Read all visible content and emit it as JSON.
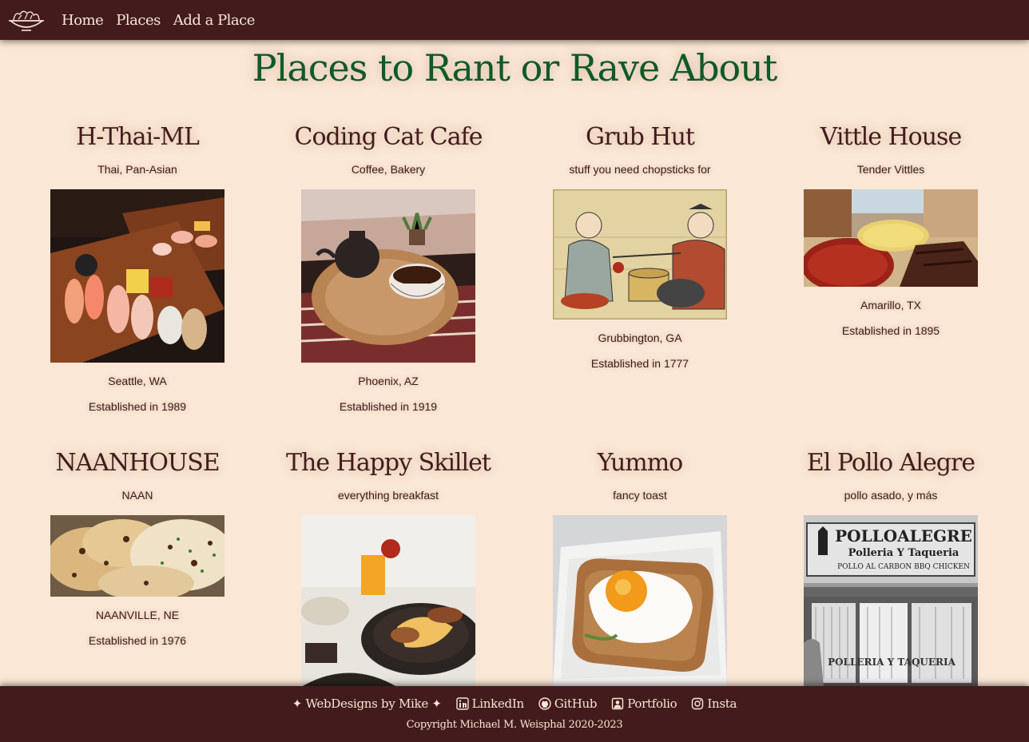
{
  "nav": {
    "logo_icon": "salad-bowl-icon",
    "items": [
      {
        "label": "Home"
      },
      {
        "label": "Places"
      },
      {
        "label": "Add a Place"
      }
    ]
  },
  "page": {
    "title": "Places to Rant or Rave About"
  },
  "places": [
    {
      "name": "H-Thai-ML",
      "cuisine": "Thai, Pan-Asian",
      "city": "Seattle, WA",
      "founded": "Established in 1989",
      "photo": "sushi-platter"
    },
    {
      "name": "Coding Cat Cafe",
      "cuisine": "Coffee, Bakery",
      "city": "Phoenix, AZ",
      "founded": "Established in 1919",
      "photo": "teapot-and-cup"
    },
    {
      "name": "Grub Hut",
      "cuisine": "stuff you need chopsticks for",
      "city": "Grubbington, GA",
      "founded": "Established in 1777",
      "photo": "ancient-painting"
    },
    {
      "name": "Vittle House",
      "cuisine": "Tender Vittles",
      "city": "Amarillo, TX",
      "founded": "Established in 1895",
      "photo": "western-town-food"
    },
    {
      "name": "NAANHOUSE",
      "cuisine": "NAAN",
      "city": "NAANVILLE, NE",
      "founded": "Established in 1976",
      "photo": "naan-bread"
    },
    {
      "name": "The Happy Skillet",
      "cuisine": "everything breakfast",
      "city": "",
      "founded": "",
      "photo": "breakfast-skillet"
    },
    {
      "name": "Yummo",
      "cuisine": "fancy toast",
      "city": "",
      "founded": "",
      "photo": "egg-toast"
    },
    {
      "name": "El Pollo Alegre",
      "cuisine": "pollo asado, y más",
      "city": "",
      "founded": "",
      "photo": "storefront",
      "sign": {
        "line1": "POLLOALEGRE",
        "line2": "Polleria Y Taqueria",
        "line3": "POLLO AL CARBON  BBQ CHICKEN",
        "window": "POLLERIA Y TAQUERIA"
      }
    }
  ],
  "footer": {
    "brand": "✦ WebDesigns by Mike ✦",
    "links": [
      {
        "label": "LinkedIn",
        "icon": "linkedin-icon"
      },
      {
        "label": "GitHub",
        "icon": "github-icon"
      },
      {
        "label": "Portfolio",
        "icon": "portfolio-icon"
      },
      {
        "label": "Insta",
        "icon": "instagram-icon"
      }
    ],
    "copyright": "Copyright Michael M. Weisphal 2020-2023"
  },
  "colors": {
    "nav_bg": "#431b1c",
    "page_bg": "#fbe7d5",
    "title": "#0e5a25",
    "heading": "#431b1c"
  }
}
